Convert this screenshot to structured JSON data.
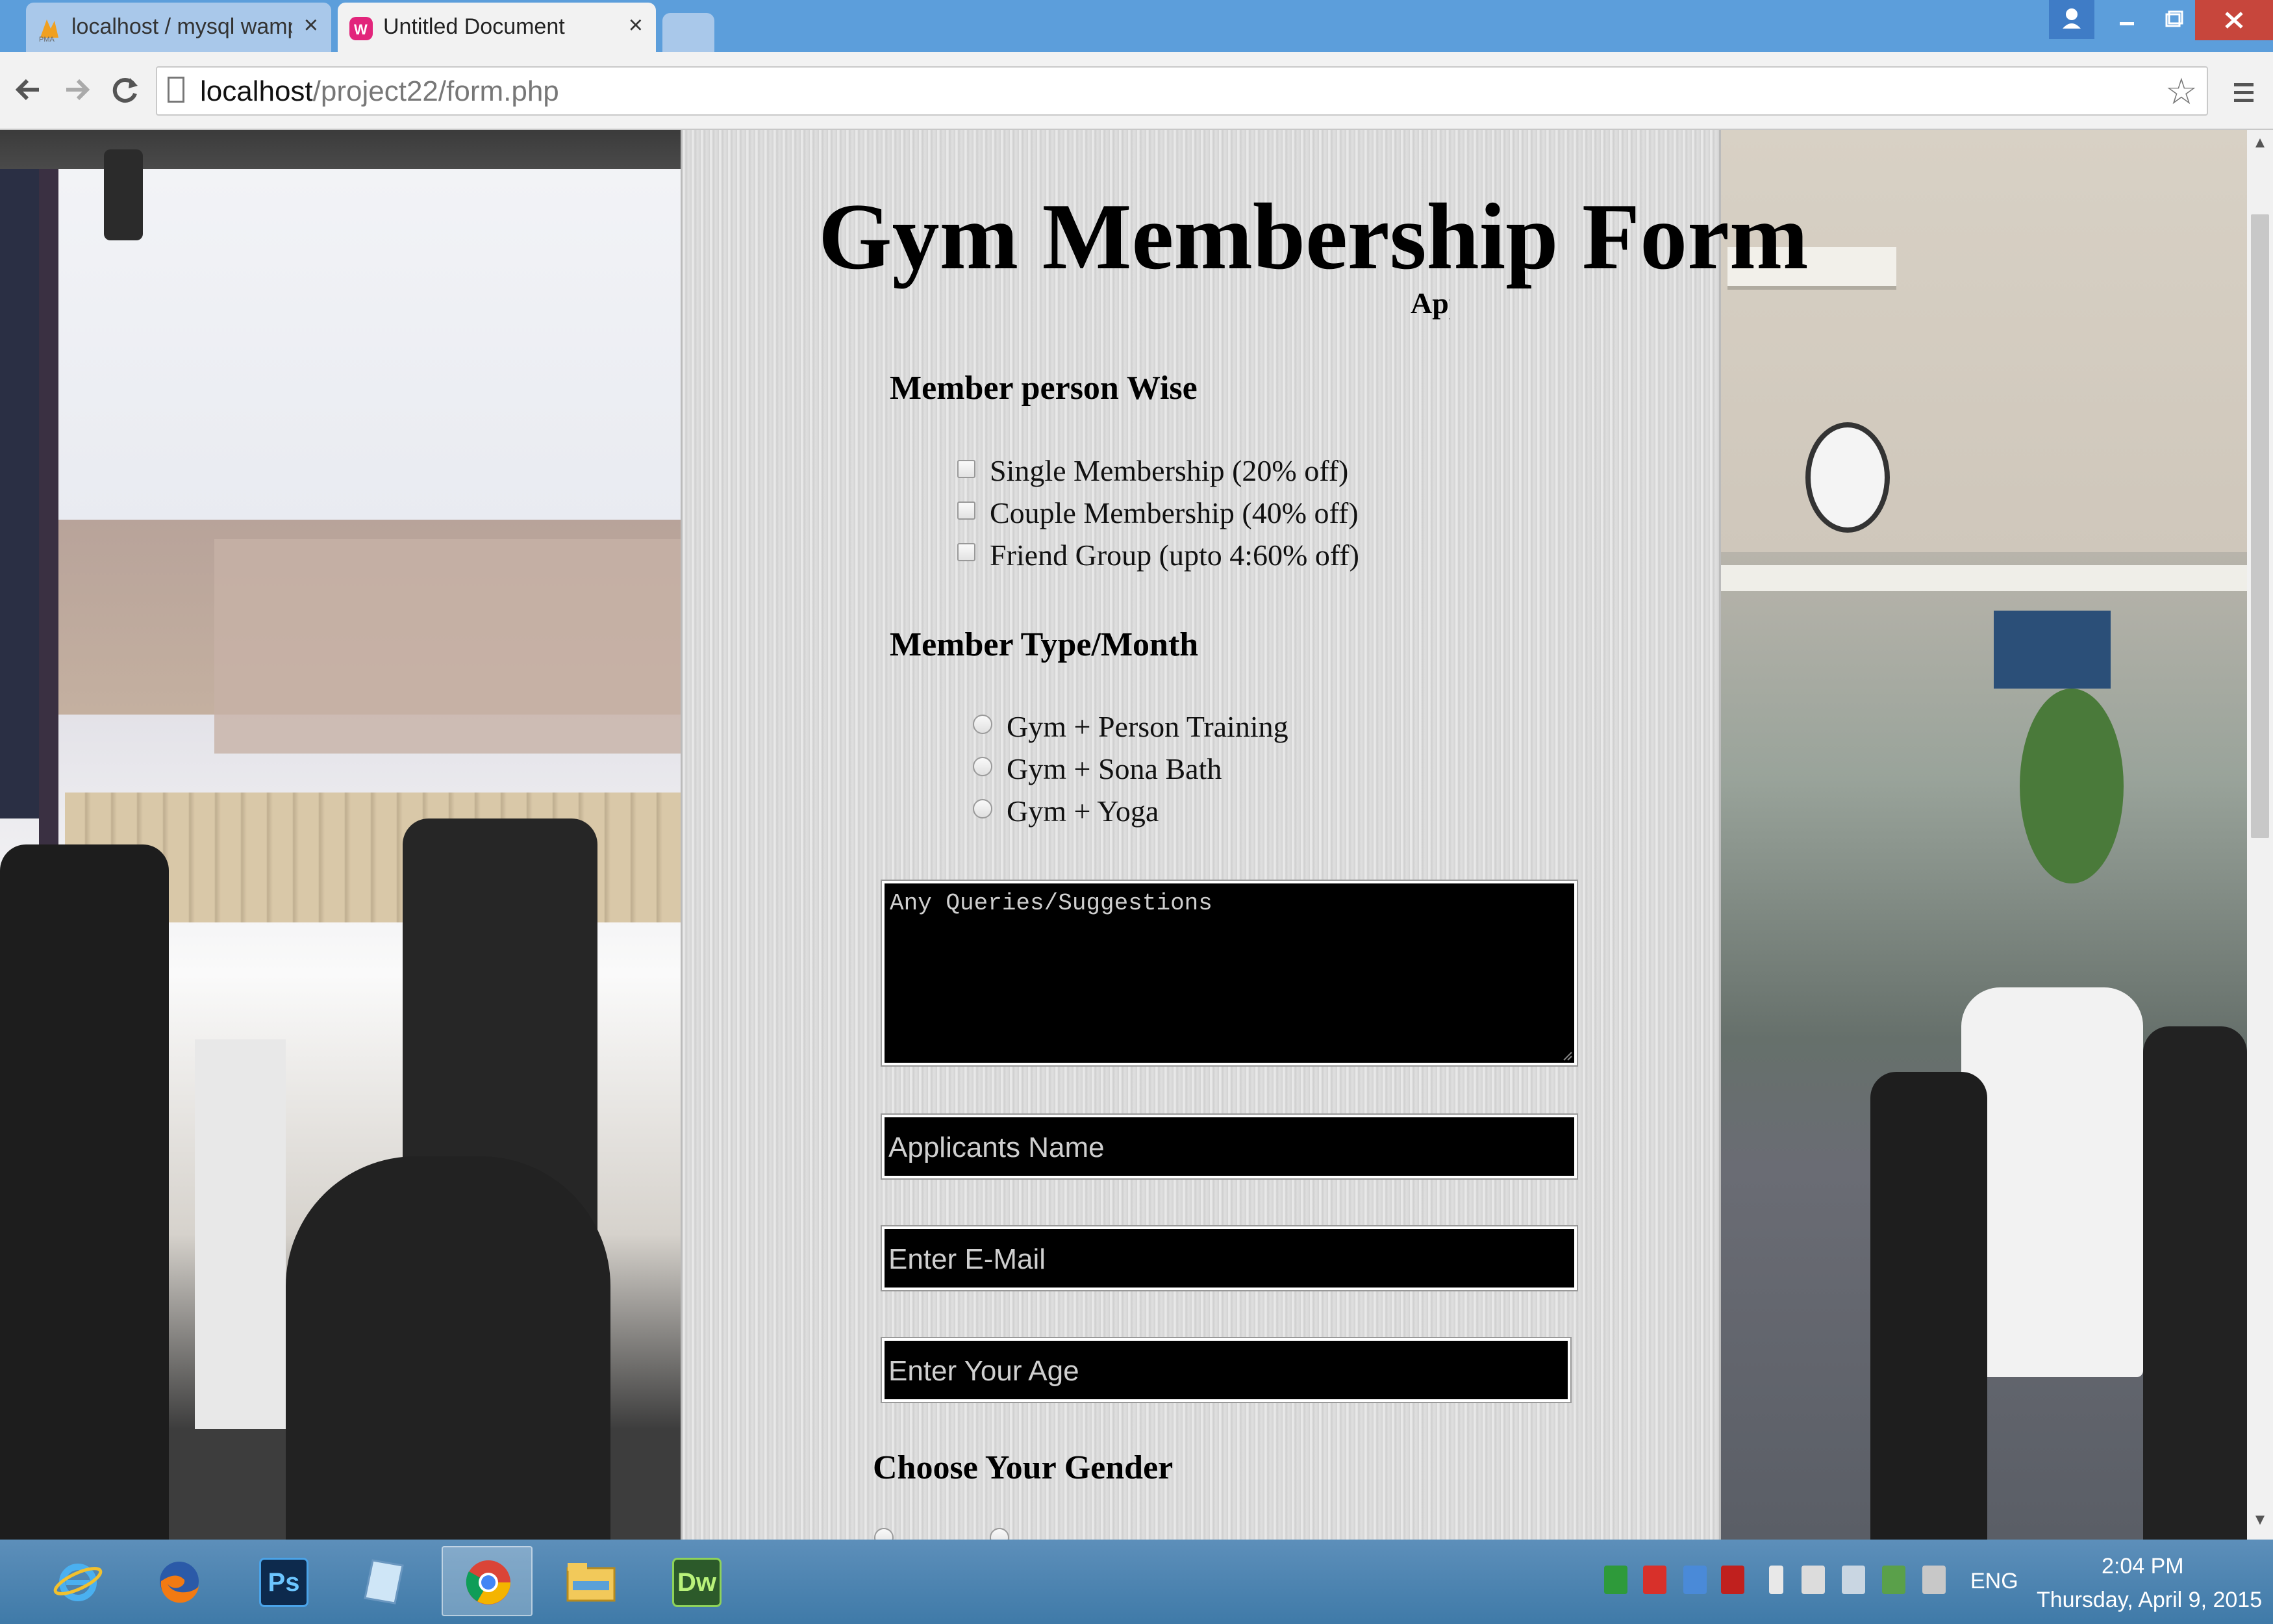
{
  "browser": {
    "tabs": [
      {
        "title": "localhost / mysql wampse"
      },
      {
        "title": "Untitled Document"
      }
    ],
    "address": {
      "host": "localhost",
      "path": "/project22/form.php"
    }
  },
  "form": {
    "title": "Gym Membership Form",
    "marquee_text": "Application",
    "member_person": {
      "heading": "Member person Wise",
      "options": [
        "Single Membership (20% off)",
        "Couple Membership (40% off)",
        "Friend Group (upto 4:60% off)"
      ]
    },
    "member_type": {
      "heading": "Member Type/Month",
      "options": [
        "Gym + Person Training",
        "Gym + Sona Bath",
        "Gym + Yoga"
      ]
    },
    "queries_placeholder": "Any Queries/Suggestions",
    "name_placeholder": "Applicants Name",
    "email_placeholder": "Enter E-Mail",
    "age_placeholder": "Enter Your Age",
    "gender_heading": "Choose Your Gender"
  },
  "taskbar": {
    "apps": [
      {
        "icon": "internet-explorer-icon"
      },
      {
        "icon": "firefox-icon"
      },
      {
        "icon": "photoshop-icon",
        "label": "Ps"
      },
      {
        "icon": "notepad-icon"
      },
      {
        "icon": "chrome-icon"
      },
      {
        "icon": "file-explorer-icon"
      },
      {
        "icon": "dreamweaver-icon",
        "label": "Dw"
      }
    ],
    "language": "ENG",
    "time": "2:04 PM",
    "date": "Thursday, April 9, 2015"
  },
  "colors": {
    "titlebar": "#5c9edb",
    "close": "#c7463c",
    "field": "#000000"
  }
}
